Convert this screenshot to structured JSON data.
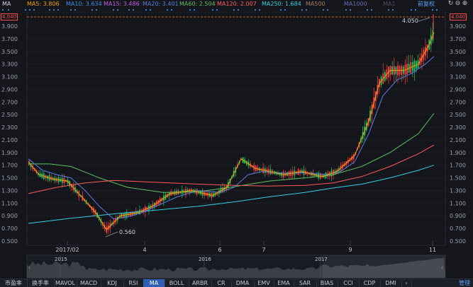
{
  "indicator_name": "MA",
  "ma_legend": [
    {
      "label": "MA5: 3.806",
      "color": "#f0a000"
    },
    {
      "label": "MA10: 3.634",
      "color": "#3a8ee6"
    },
    {
      "label": "MA15: 3.486",
      "color": "#c060e0"
    },
    {
      "label": "MA20: 3.401",
      "color": "#5a7de0"
    },
    {
      "label": "MA60: 2.504",
      "color": "#5fbf5f"
    },
    {
      "label": "MA120: 2.007",
      "color": "#ff5a5a"
    },
    {
      "label": "MA250: 1.684",
      "color": "#34d0e0"
    },
    {
      "label": "MA500",
      "color": "#a08060"
    },
    {
      "label": "MA1000",
      "color": "#6a6ab0"
    },
    {
      "label": "MA1",
      "color": "#4a4e58"
    }
  ],
  "adjust_mode": "前复权",
  "chart_data": {
    "type": "line",
    "title": "",
    "current_price": "4.040",
    "high_annotation": "4.050",
    "low_annotation": "0.560",
    "y_ticks": [
      "3.900",
      "3.700",
      "3.500",
      "3.300",
      "3.100",
      "2.900",
      "2.700",
      "2.500",
      "2.300",
      "2.100",
      "1.900",
      "1.700",
      "1.500",
      "1.300",
      "1.100",
      "0.900",
      "0.700",
      "0.500"
    ],
    "ylim": [
      0.5,
      4.05
    ],
    "x_ticks": [
      {
        "label": "2017/02",
        "x": 95
      },
      {
        "label": "4",
        "x": 204
      },
      {
        "label": "6",
        "x": 310
      },
      {
        "label": "7",
        "x": 372
      },
      {
        "label": "9",
        "x": 494
      },
      {
        "label": "11",
        "x": 610
      }
    ],
    "overview_years": [
      {
        "label": "2015",
        "x": 85
      },
      {
        "label": "2016",
        "x": 288
      },
      {
        "label": "2017",
        "x": 452
      }
    ],
    "ma_lines": [
      {
        "name": "MA60",
        "color": "#5fbf5f",
        "points": [
          [
            40,
            1.72
          ],
          [
            70,
            1.72
          ],
          [
            100,
            1.68
          ],
          [
            140,
            1.5
          ],
          [
            180,
            1.35
          ],
          [
            230,
            1.27
          ],
          [
            280,
            1.28
          ],
          [
            330,
            1.36
          ],
          [
            380,
            1.45
          ],
          [
            430,
            1.5
          ],
          [
            470,
            1.55
          ],
          [
            510,
            1.68
          ],
          [
            550,
            1.9
          ],
          [
            590,
            2.2
          ],
          [
            612,
            2.52
          ]
        ]
      },
      {
        "name": "MA120",
        "color": "#ff5a5a",
        "points": [
          [
            40,
            1.25
          ],
          [
            80,
            1.35
          ],
          [
            120,
            1.42
          ],
          [
            160,
            1.46
          ],
          [
            200,
            1.44
          ],
          [
            240,
            1.42
          ],
          [
            280,
            1.4
          ],
          [
            330,
            1.38
          ],
          [
            380,
            1.37
          ],
          [
            430,
            1.38
          ],
          [
            470,
            1.42
          ],
          [
            510,
            1.52
          ],
          [
            550,
            1.68
          ],
          [
            590,
            1.88
          ],
          [
            612,
            2.02
          ]
        ]
      },
      {
        "name": "MA250",
        "color": "#34d0e0",
        "points": [
          [
            40,
            0.78
          ],
          [
            100,
            0.86
          ],
          [
            160,
            0.93
          ],
          [
            220,
            0.99
          ],
          [
            280,
            1.05
          ],
          [
            330,
            1.12
          ],
          [
            380,
            1.2
          ],
          [
            430,
            1.27
          ],
          [
            470,
            1.34
          ],
          [
            510,
            1.4
          ],
          [
            550,
            1.5
          ],
          [
            590,
            1.62
          ],
          [
            612,
            1.7
          ]
        ]
      },
      {
        "name": "MA20",
        "color": "#5a7de0",
        "points": [
          [
            40,
            1.8
          ],
          [
            60,
            1.62
          ],
          [
            80,
            1.55
          ],
          [
            100,
            1.5
          ],
          [
            120,
            1.3
          ],
          [
            140,
            1.05
          ],
          [
            160,
            0.85
          ],
          [
            180,
            0.88
          ],
          [
            200,
            0.95
          ],
          [
            220,
            1.05
          ],
          [
            250,
            1.2
          ],
          [
            280,
            1.3
          ],
          [
            310,
            1.27
          ],
          [
            330,
            1.35
          ],
          [
            350,
            1.55
          ],
          [
            370,
            1.6
          ],
          [
            400,
            1.57
          ],
          [
            430,
            1.58
          ],
          [
            460,
            1.55
          ],
          [
            480,
            1.6
          ],
          [
            500,
            1.75
          ],
          [
            520,
            2.2
          ],
          [
            540,
            2.8
          ],
          [
            560,
            3.05
          ],
          [
            580,
            3.15
          ],
          [
            600,
            3.3
          ],
          [
            612,
            3.42
          ]
        ]
      },
      {
        "name": "MA5",
        "color": "#f0a000",
        "points": [
          [
            40,
            1.75
          ],
          [
            55,
            1.55
          ],
          [
            75,
            1.48
          ],
          [
            95,
            1.45
          ],
          [
            115,
            1.2
          ],
          [
            135,
            0.95
          ],
          [
            150,
            0.68
          ],
          [
            170,
            0.9
          ],
          [
            195,
            0.95
          ],
          [
            215,
            1.05
          ],
          [
            240,
            1.25
          ],
          [
            270,
            1.3
          ],
          [
            300,
            1.22
          ],
          [
            320,
            1.35
          ],
          [
            340,
            1.8
          ],
          [
            360,
            1.65
          ],
          [
            380,
            1.6
          ],
          [
            400,
            1.55
          ],
          [
            425,
            1.6
          ],
          [
            455,
            1.52
          ],
          [
            475,
            1.6
          ],
          [
            500,
            1.85
          ],
          [
            520,
            2.4
          ],
          [
            535,
            3.0
          ],
          [
            550,
            3.2
          ],
          [
            570,
            3.2
          ],
          [
            590,
            3.3
          ],
          [
            605,
            3.6
          ],
          [
            612,
            3.8
          ]
        ]
      }
    ]
  },
  "bottom_tabs": [
    "市盈率",
    "换手率",
    "MAVOL",
    "MACD",
    "KDJ",
    "RSI",
    "MA",
    "BOLL",
    "ARBR",
    "CR",
    "DMA",
    "EMV",
    "EMA",
    "SAR",
    "BIAS",
    "CCI",
    "CDP",
    "DMI"
  ],
  "active_tab": "MA",
  "more_arrow": "›",
  "manage_label": "管理"
}
